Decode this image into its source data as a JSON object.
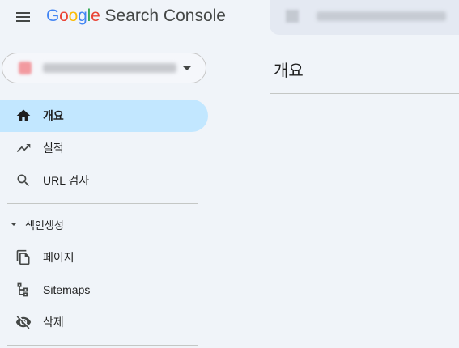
{
  "header": {
    "logo_google": "Google",
    "logo_product": "Search Console",
    "colors": {
      "blue": "#4285F4",
      "red": "#EA4335",
      "yellow": "#FBBC05",
      "green": "#34A853"
    }
  },
  "nav": {
    "items": [
      {
        "label": "개요",
        "icon": "home-icon",
        "active": true
      },
      {
        "label": "실적",
        "icon": "trending-up-icon",
        "active": false
      },
      {
        "label": "URL 검사",
        "icon": "search-icon",
        "active": false
      }
    ],
    "section": {
      "label": "색인생성",
      "items": [
        {
          "label": "페이지",
          "icon": "pages-icon"
        },
        {
          "label": "Sitemaps",
          "icon": "sitemap-icon"
        },
        {
          "label": "삭제",
          "icon": "visibility-off-icon"
        }
      ]
    }
  },
  "main": {
    "title": "개요"
  },
  "colors": {
    "active_bg": "#c2e7ff",
    "page_bg": "#f0f4f9"
  }
}
